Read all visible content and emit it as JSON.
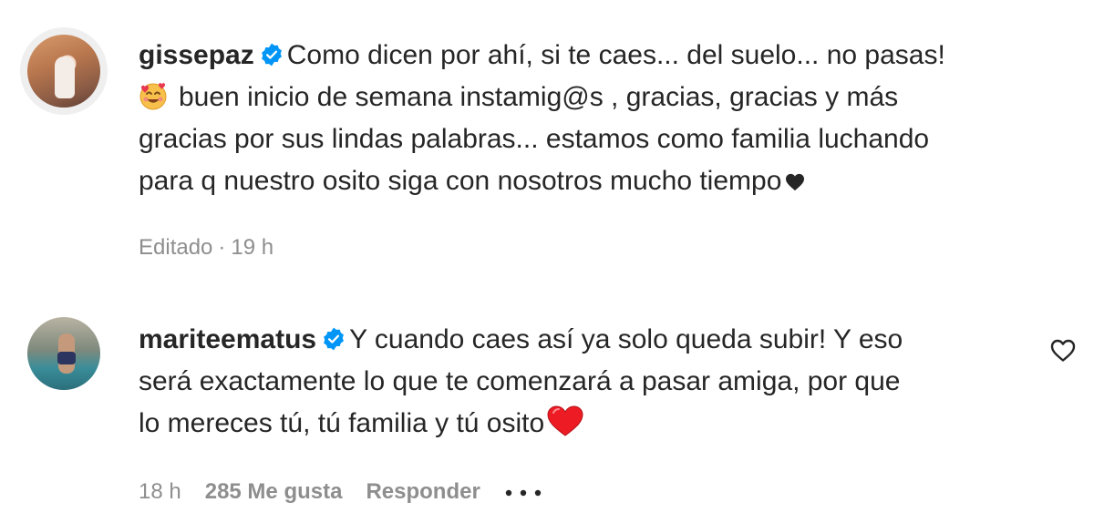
{
  "comments": [
    {
      "username": "gissepaz",
      "verified": true,
      "lines": [
        "Como dicen por ahí, si te caes... del suelo... no pasas!",
        "buen inicio de semana instamig@s , gracias, gracias y más",
        "gracias por sus lindas palabras... estamos como familia luchando",
        "para q nuestro osito siga con nosotros mucho tiempo"
      ],
      "meta": {
        "edited": "Editado",
        "separator": "·",
        "time": "19 h"
      }
    },
    {
      "username": "mariteematus",
      "verified": true,
      "lines": [
        "Y cuando caes así ya solo queda subir! Y eso",
        "será exactamente lo que te comenzará a pasar amiga, por que",
        "lo mereces tú, tú familia y tú osito"
      ],
      "meta": {
        "time": "18 h",
        "likes": "285 Me gusta",
        "reply": "Responder"
      }
    }
  ],
  "colors": {
    "text": "#262626",
    "secondary": "#8e8e8e",
    "verified": "#0095f6",
    "heart_red": "#ed1c24"
  },
  "icons": [
    "verified-badge-icon",
    "smiling-face-with-hearts-icon",
    "black-heart-icon",
    "red-heart-icon",
    "like-heart-outline-icon",
    "more-options-icon"
  ]
}
